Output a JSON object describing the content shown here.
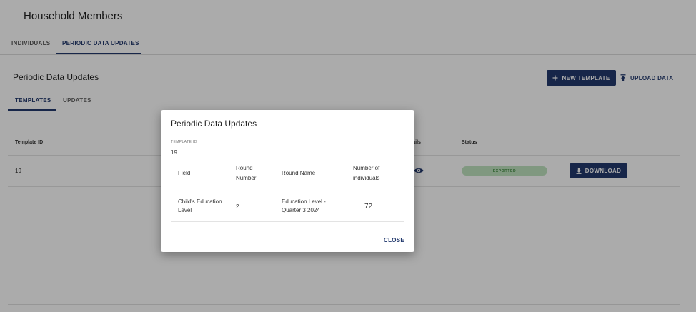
{
  "header": {
    "title": "Household Members",
    "tabs": [
      {
        "label": "INDIVIDUALS"
      },
      {
        "label": "PERIODIC DATA UPDATES"
      }
    ]
  },
  "section": {
    "title": "Periodic Data Updates",
    "new_template_label": "NEW TEMPLATE",
    "upload_label": "UPLOAD DATA",
    "sub_tabs": [
      {
        "label": "TEMPLATES"
      },
      {
        "label": "UPDATES"
      }
    ]
  },
  "table": {
    "columns": {
      "template_id": "Template ID",
      "details": "Details",
      "status": "Status"
    },
    "rows": [
      {
        "template_id": "19",
        "status": "EXPORTED",
        "action": "DOWNLOAD"
      }
    ]
  },
  "dialog": {
    "title": "Periodic Data Updates",
    "template_id_label": "TEMPLATE ID",
    "template_id_value": "19",
    "columns": {
      "field": "Field",
      "round_number": "Round Number",
      "round_name": "Round Name",
      "num_individuals": "Number of individuals"
    },
    "rows": [
      {
        "field": "Child's Education Level",
        "round_number": "2",
        "round_name": "Education Level - Quarter 3 2024",
        "num_individuals": "72"
      }
    ],
    "close_label": "CLOSE"
  },
  "colors": {
    "primary": "#233a6e",
    "status_bg": "#bfe3bf",
    "status_text": "#3f8a3f"
  },
  "icons": {
    "new_template": "plus-icon",
    "upload": "upload-icon",
    "details": "eye-icon",
    "download": "download-icon"
  }
}
